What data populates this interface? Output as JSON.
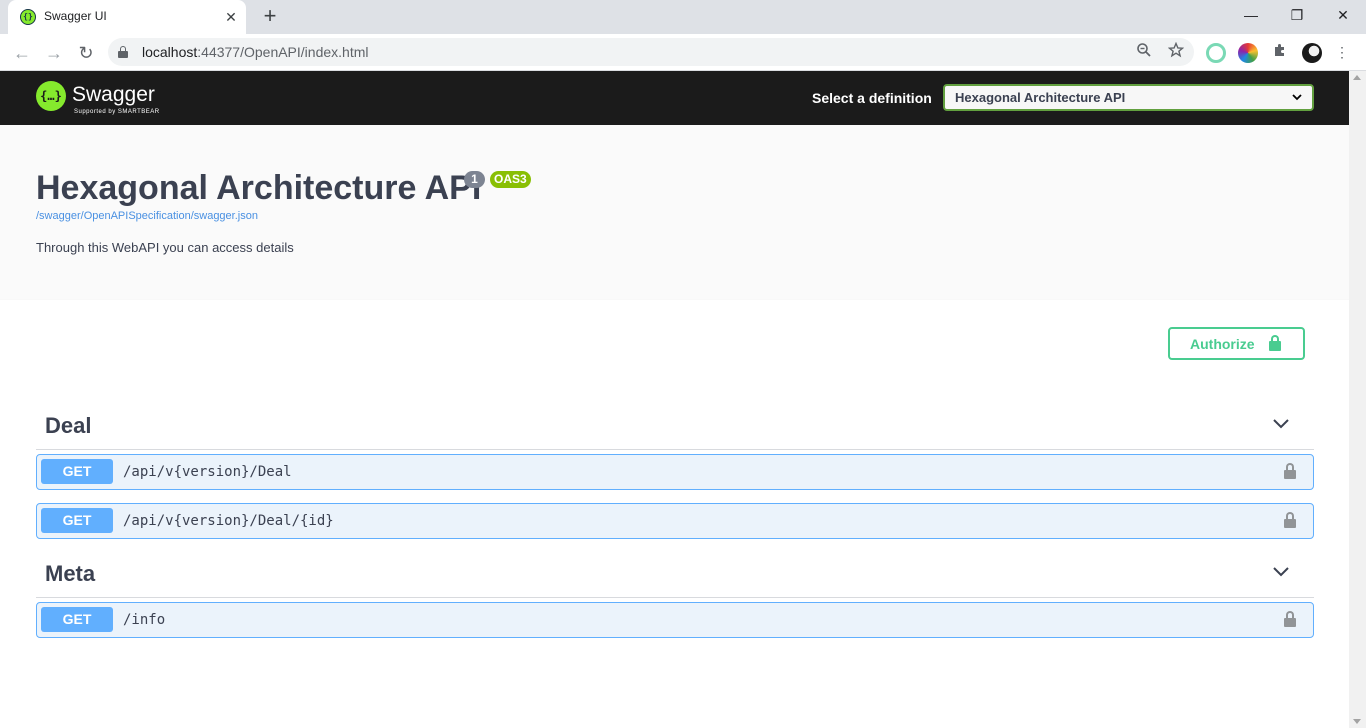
{
  "browser": {
    "tab_title": "Swagger UI",
    "tab_close": "✕",
    "new_tab": "+",
    "url_host": "localhost",
    "url_rest": ":44377/OpenAPI/index.html",
    "window_controls": {
      "minimize": "—",
      "restore": "❐",
      "close": "✕"
    },
    "nav": {
      "back": "←",
      "forward": "→",
      "reload": "↻"
    },
    "icons": [
      "zoom-out-icon",
      "bookmark-star-icon",
      "extension-1-icon",
      "color-picker-extension-icon",
      "extensions-puzzle-icon",
      "profile-avatar-icon"
    ]
  },
  "swagger": {
    "brand": "Swagger",
    "brand_sub": "Supported by SMARTBEAR",
    "logo_glyph": "{…}",
    "definition_label": "Select a definition",
    "definition_value": "Hexagonal Architecture API",
    "colors": {
      "topbar": "#1b1b1b",
      "accent": "#85ea2d",
      "get": "#61affe",
      "authorize": "#49cc90"
    }
  },
  "info": {
    "title": "Hexagonal Architecture API",
    "version": "1",
    "oas_badge": "OAS3",
    "spec_url": "/swagger/OpenAPISpecification/swagger.json",
    "description": "Through this WebAPI you can access details"
  },
  "authorize": {
    "label": "Authorize"
  },
  "tags": [
    {
      "name": "Deal",
      "operations": [
        {
          "method": "GET",
          "path": "/api/v{version}/Deal"
        },
        {
          "method": "GET",
          "path": "/api/v{version}/Deal/{id}"
        }
      ]
    },
    {
      "name": "Meta",
      "operations": [
        {
          "method": "GET",
          "path": "/info"
        }
      ]
    }
  ]
}
